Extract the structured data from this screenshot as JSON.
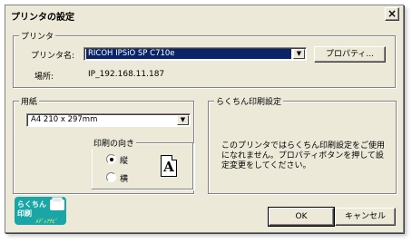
{
  "window": {
    "title": "プリンタの設定",
    "close_glyph": "×"
  },
  "printer_group": {
    "label": "プリンタ",
    "name_label": "プリンタ名:",
    "name_value": "RICOH IPSiO SP C710e",
    "properties_button": "プロパティ...",
    "location_label": "場所:",
    "location_value": "IP_192.168.11.187"
  },
  "paper_group": {
    "label": "用紙",
    "size_value": "A4 210 x 297mm",
    "orientation": {
      "label": "印刷の向き",
      "portrait": "縦",
      "landscape": "横",
      "selected": "portrait",
      "icon_letter": "A"
    }
  },
  "rakuchin_group": {
    "label": "らくちん印刷設定",
    "description": "このプリンタではらくちん印刷設定をご使用になれません。プロパティボタンを押して設定変更をしてください。"
  },
  "logo": {
    "line1": "らくちん",
    "line2": "印刷",
    "line3": "ﾒﾃﾞｨｱﾅﾋﾞ",
    "brand_color": "#1aa6a6"
  },
  "buttons": {
    "ok": "OK",
    "cancel": "キャンセル"
  },
  "icons": {
    "dropdown": "▼"
  }
}
